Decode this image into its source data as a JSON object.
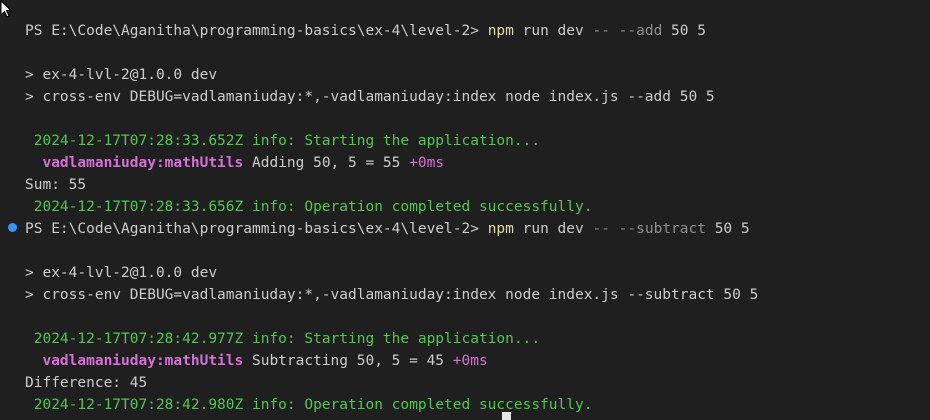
{
  "terminal": {
    "block1": {
      "prompt": "PS E:\\Code\\Aganitha\\programming-basics\\ex-4\\level-2> ",
      "cmd_npm": "npm",
      "cmd_run": " run dev ",
      "cmd_sep": "--",
      "cmd_flag": " --add",
      "cmd_args": " 50 5",
      "pkg_line": "> ex-4-lvl-2@1.0.0 dev",
      "cross_line": "> cross-env DEBUG=vadlamaniuday:*,-vadlamaniuday:index node index.js --add 50 5",
      "log_start": " 2024-12-17T07:28:33.652Z info: Starting the application...",
      "debug_ns": "  vadlamaniuday:mathUtils",
      "debug_msg": " Adding 50, 5 = 55 ",
      "debug_ms": "+0ms",
      "result": "Sum: 55",
      "log_done": " 2024-12-17T07:28:33.656Z info: Operation completed successfully."
    },
    "block2": {
      "prompt": "PS E:\\Code\\Aganitha\\programming-basics\\ex-4\\level-2> ",
      "cmd_npm": "npm",
      "cmd_run": " run dev ",
      "cmd_sep": "--",
      "cmd_flag": " --subtract",
      "cmd_args": " 50 5",
      "pkg_line": "> ex-4-lvl-2@1.0.0 dev",
      "cross_line": "> cross-env DEBUG=vadlamaniuday:*,-vadlamaniuday:index node index.js --subtract 50 5",
      "log_start": " 2024-12-17T07:28:42.977Z info: Starting the application...",
      "debug_ns": "  vadlamaniuday:mathUtils",
      "debug_msg": " Subtracting 50, 5 = 45 ",
      "debug_ms": "+0ms",
      "result": "Difference: 45",
      "log_done": " 2024-12-17T07:28:42.980Z info: Operation completed successfully."
    }
  },
  "colors": {
    "background": "#1f1f1f",
    "text": "#cccccc",
    "npm": "#dcdcaa",
    "log_green": "#4ec94e",
    "debug_magenta": "#d670d6",
    "status_dot": "#3794ff"
  }
}
